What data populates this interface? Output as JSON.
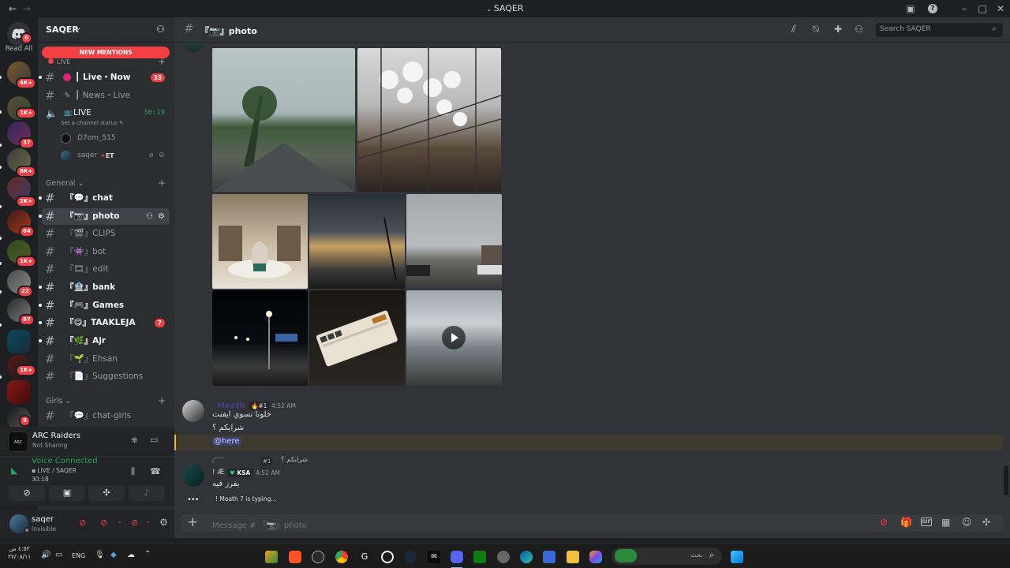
{
  "window": {
    "title": "SAQER"
  },
  "rail": {
    "read_all": "Read All",
    "top_badge": "6",
    "servers": [
      {
        "name": "server-1",
        "badge": "4K+"
      },
      {
        "name": "server-2",
        "badge": "1K+"
      },
      {
        "name": "server-3",
        "badge": "37"
      },
      {
        "name": "server-4",
        "badge": "8K+"
      },
      {
        "name": "server-5",
        "badge": "2K+"
      },
      {
        "name": "server-6",
        "badge": "64"
      },
      {
        "name": "server-7",
        "badge": "1K+"
      },
      {
        "name": "server-8",
        "badge": "22"
      },
      {
        "name": "server-9",
        "badge": "87"
      },
      {
        "name": "server-10",
        "badge": ""
      },
      {
        "name": "server-11",
        "badge": "1K+"
      },
      {
        "name": "server-12",
        "badge": ""
      },
      {
        "name": "server-13",
        "badge": "9"
      }
    ]
  },
  "sidebar": {
    "server_name": "SAQER",
    "new_mentions": "NEW MENTIONS",
    "live_category": "LIVE",
    "live_channels": [
      {
        "label": "┃ Live・Now",
        "badge": "33"
      },
      {
        "label": "┃ News・Live",
        "badge": ""
      }
    ],
    "voice": {
      "label": "LIVE",
      "timer": "30:19",
      "status": "Set a channel status",
      "members": [
        {
          "name": "D7om_515",
          "tag": ""
        },
        {
          "name": "saqer",
          "tag": "ET"
        }
      ]
    },
    "general_category": "General",
    "channels": [
      {
        "label": "『💬』chat",
        "unread": true,
        "badge": ""
      },
      {
        "label": "『📷』photo",
        "unread": true,
        "badge": "",
        "selected": true
      },
      {
        "label": "『🎬』CLIPS",
        "unread": false,
        "badge": ""
      },
      {
        "label": "『👾』bot",
        "unread": false,
        "badge": ""
      },
      {
        "label": "『🎞』edit",
        "unread": false,
        "badge": ""
      },
      {
        "label": "『🏦』bank",
        "unread": true,
        "badge": ""
      },
      {
        "label": "『🎮』Games",
        "unread": true,
        "badge": ""
      },
      {
        "label": "『😋』TAAKLEJA",
        "unread": true,
        "badge": "7"
      },
      {
        "label": "『🌿』Ajr",
        "unread": true,
        "badge": ""
      },
      {
        "label": "『🌱』Ehsan",
        "unread": false,
        "badge": ""
      },
      {
        "label": "『📄』Suggestions",
        "unread": false,
        "badge": ""
      }
    ],
    "girls_category": "Girls",
    "girls_channels": [
      {
        "label": "『💬』chat-girls"
      }
    ]
  },
  "activity": {
    "game": "ARC Raiders",
    "sub": "Not Sharing"
  },
  "voice_panel": {
    "status": "Voice Connected",
    "channel": "LIVE / SAQER",
    "timer": "30:18"
  },
  "user": {
    "name": "saqer",
    "status": "Invisible"
  },
  "header": {
    "channel": "『📷』photo",
    "search_placeholder": "Search SAQER"
  },
  "messages": [
    {
      "author": "Moath",
      "tag": "#1",
      "time": "4:52 AM",
      "lines": [
        "خلونا نسوي ايفنت",
        "شرايكم ؟"
      ],
      "mention": "@here"
    },
    {
      "reply": "شرايكم ؟",
      "reply_tag": "#1",
      "author": "! Æ",
      "tag": "KSA",
      "time": "4:52 AM",
      "lines": [
        "بفرز فيه"
      ]
    }
  ],
  "typing": "! Moath 7 is typing...",
  "composer": {
    "placeholder": "Message # 『📷』photo"
  },
  "taskbar": {
    "time": "٤:٥٢ ص",
    "date": "٢٧/٠٨/١١",
    "lang": "ENG",
    "search": "بحث"
  }
}
